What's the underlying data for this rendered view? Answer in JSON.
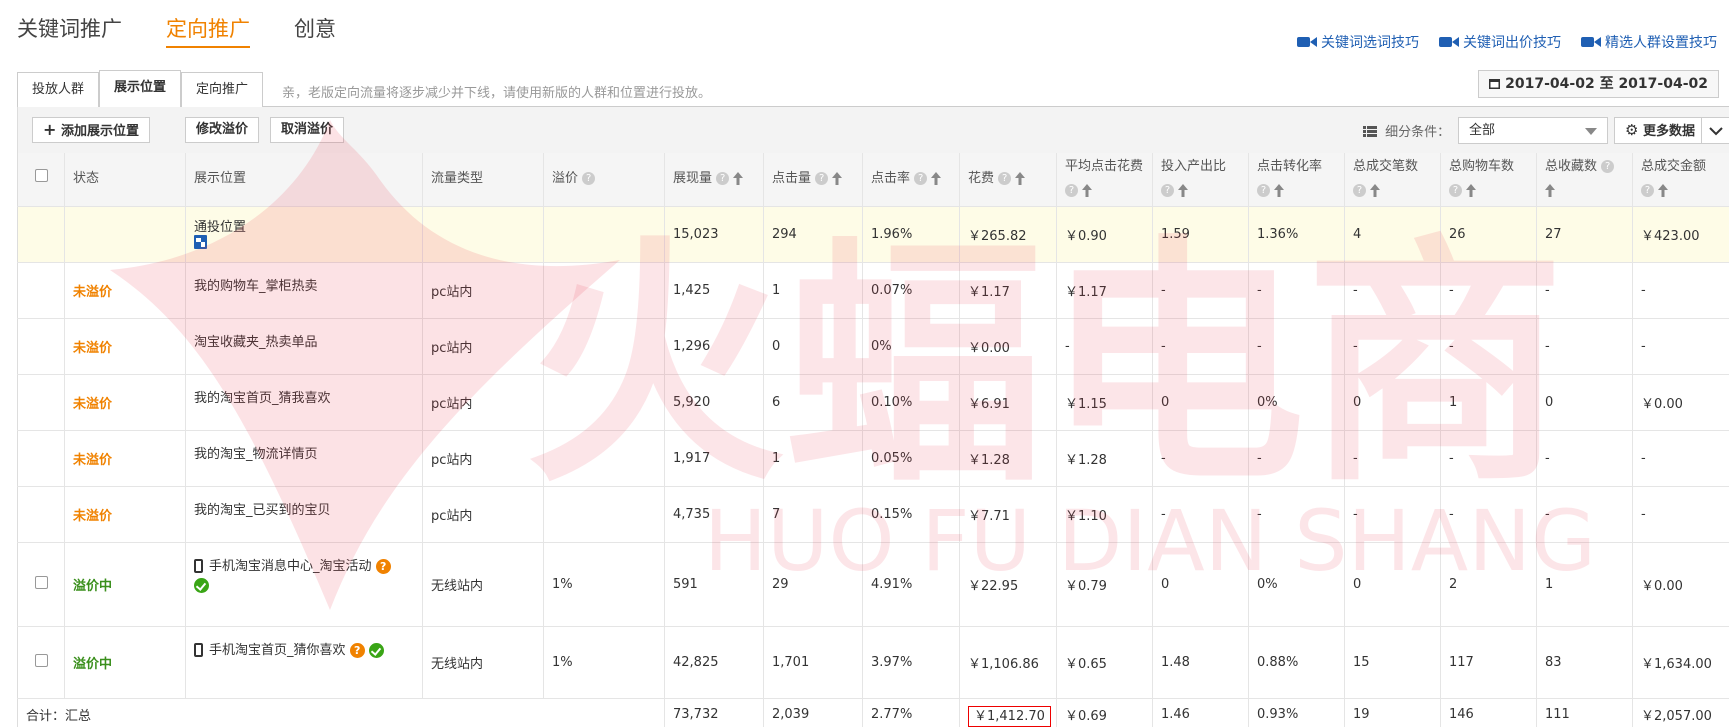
{
  "topnav": {
    "tabs": [
      "关键词推广",
      "定向推广",
      "创意"
    ],
    "active": 1
  },
  "tips": [
    "关键词选词技巧",
    "关键词出价技巧",
    "精选人群设置技巧"
  ],
  "subtabs": [
    "投放人群",
    "展示位置",
    "定向推广"
  ],
  "notice": "亲，老版定向流量将逐步减少并下线，请使用新版的人群和位置进行投放。",
  "date_range": "2017-04-02 至 2017-04-02",
  "toolbar": {
    "add": "添加展示位置",
    "modify": "修改溢价",
    "cancel": "取消溢价",
    "filter_label": "细分条件：",
    "filter_value": "全部",
    "more": "更多数据"
  },
  "columns": [
    "状态",
    "展示位置",
    "流量类型",
    "溢价",
    "展现量",
    "点击量",
    "点击率",
    "花费",
    "平均点击花费",
    "投入产出比",
    "点击转化率",
    "总成交笔数",
    "总购物车数",
    "总收藏数",
    "总成交金额"
  ],
  "rows": [
    {
      "status": "",
      "position": "通投位置",
      "traffic": "",
      "premium": "",
      "impr": "15,023",
      "clicks": "294",
      "ctr": "1.96%",
      "cost": "￥265.82",
      "cpc": "￥0.90",
      "roi": "1.59",
      "cvr": "1.36%",
      "orders": "4",
      "cart": "26",
      "fav": "27",
      "gmv": "￥423.00"
    },
    {
      "status": "未溢价",
      "position": "我的购物车_掌柜热卖",
      "traffic": "pc站内",
      "premium": "",
      "impr": "1,425",
      "clicks": "1",
      "ctr": "0.07%",
      "cost": "￥1.17",
      "cpc": "￥1.17",
      "roi": "-",
      "cvr": "-",
      "orders": "-",
      "cart": "-",
      "fav": "-",
      "gmv": "-"
    },
    {
      "status": "未溢价",
      "position": "淘宝收藏夹_热卖单品",
      "traffic": "pc站内",
      "premium": "",
      "impr": "1,296",
      "clicks": "0",
      "ctr": "0%",
      "cost": "￥0.00",
      "cpc": "-",
      "roi": "-",
      "cvr": "-",
      "orders": "-",
      "cart": "-",
      "fav": "-",
      "gmv": "-"
    },
    {
      "status": "未溢价",
      "position": "我的淘宝首页_猜我喜欢",
      "traffic": "pc站内",
      "premium": "",
      "impr": "5,920",
      "clicks": "6",
      "ctr": "0.10%",
      "cost": "￥6.91",
      "cpc": "￥1.15",
      "roi": "0",
      "cvr": "0%",
      "orders": "0",
      "cart": "1",
      "fav": "0",
      "gmv": "￥0.00"
    },
    {
      "status": "未溢价",
      "position": "我的淘宝_物流详情页",
      "traffic": "pc站内",
      "premium": "",
      "impr": "1,917",
      "clicks": "1",
      "ctr": "0.05%",
      "cost": "￥1.28",
      "cpc": "￥1.28",
      "roi": "-",
      "cvr": "-",
      "orders": "-",
      "cart": "-",
      "fav": "-",
      "gmv": "-"
    },
    {
      "status": "未溢价",
      "position": "我的淘宝_已买到的宝贝",
      "traffic": "pc站内",
      "premium": "",
      "impr": "4,735",
      "clicks": "7",
      "ctr": "0.15%",
      "cost": "￥7.71",
      "cpc": "￥1.10",
      "roi": "-",
      "cvr": "-",
      "orders": "-",
      "cart": "-",
      "fav": "-",
      "gmv": "-"
    },
    {
      "status": "溢价中",
      "position": "手机淘宝消息中心_淘宝活动",
      "traffic": "无线站内",
      "premium": "1%",
      "impr": "591",
      "clicks": "29",
      "ctr": "4.91%",
      "cost": "￥22.95",
      "cpc": "￥0.79",
      "roi": "0",
      "cvr": "0%",
      "orders": "0",
      "cart": "2",
      "fav": "1",
      "gmv": "￥0.00"
    },
    {
      "status": "溢价中",
      "position": "手机淘宝首页_猜你喜欢",
      "traffic": "无线站内",
      "premium": "1%",
      "impr": "42,825",
      "clicks": "1,701",
      "ctr": "3.97%",
      "cost": "￥1,106.86",
      "cpc": "￥0.65",
      "roi": "1.48",
      "cvr": "0.88%",
      "orders": "15",
      "cart": "117",
      "fav": "83",
      "gmv": "￥1,634.00"
    }
  ],
  "summary": {
    "label": "合计：汇总",
    "impr": "73,732",
    "clicks": "2,039",
    "ctr": "2.77%",
    "cost": "￥1,412.70",
    "cpc": "￥0.69",
    "roi": "1.46",
    "cvr": "0.93%",
    "orders": "19",
    "cart": "146",
    "fav": "111",
    "gmv": "￥2,057.00"
  },
  "watermark": {
    "cn": "火蝠电商",
    "en": "HUO FU DIAN SHANG"
  },
  "colors": {
    "accent": "#f08200",
    "link": "#1f5fb3",
    "green": "#3a8f1c",
    "highlight_row": "#fefce7"
  }
}
